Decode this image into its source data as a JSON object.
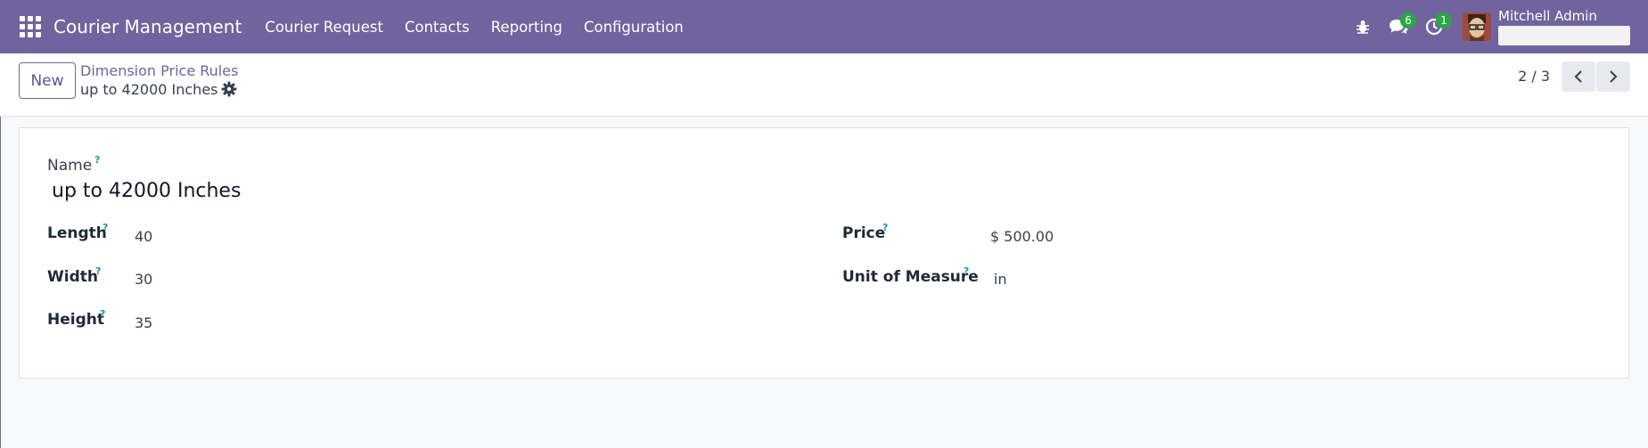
{
  "navbar": {
    "app_name": "Courier Management",
    "menu": [
      "Courier Request",
      "Contacts",
      "Reporting",
      "Configuration"
    ],
    "messages_count": "6",
    "activities_count": "1",
    "user_name": "Mitchell Admin",
    "colors": {
      "navbar_bg": "#71639e",
      "badge_bg": "#28a745"
    }
  },
  "control_panel": {
    "new_label": "New",
    "breadcrumb": "Dimension Price Rules",
    "record_title": "up to 42000 Inches",
    "pager": "2 / 3"
  },
  "form": {
    "name_label": "Name",
    "name_value": "up to 42000 Inches",
    "help_mark": "?",
    "length_label": "Length",
    "length_value": "40",
    "width_label": "Width",
    "width_value": "30",
    "height_label": "Height",
    "height_value": "35",
    "price_label": "Price",
    "price_value": "$ 500.00",
    "uom_label": "Unit of Measure",
    "uom_value": "in"
  }
}
